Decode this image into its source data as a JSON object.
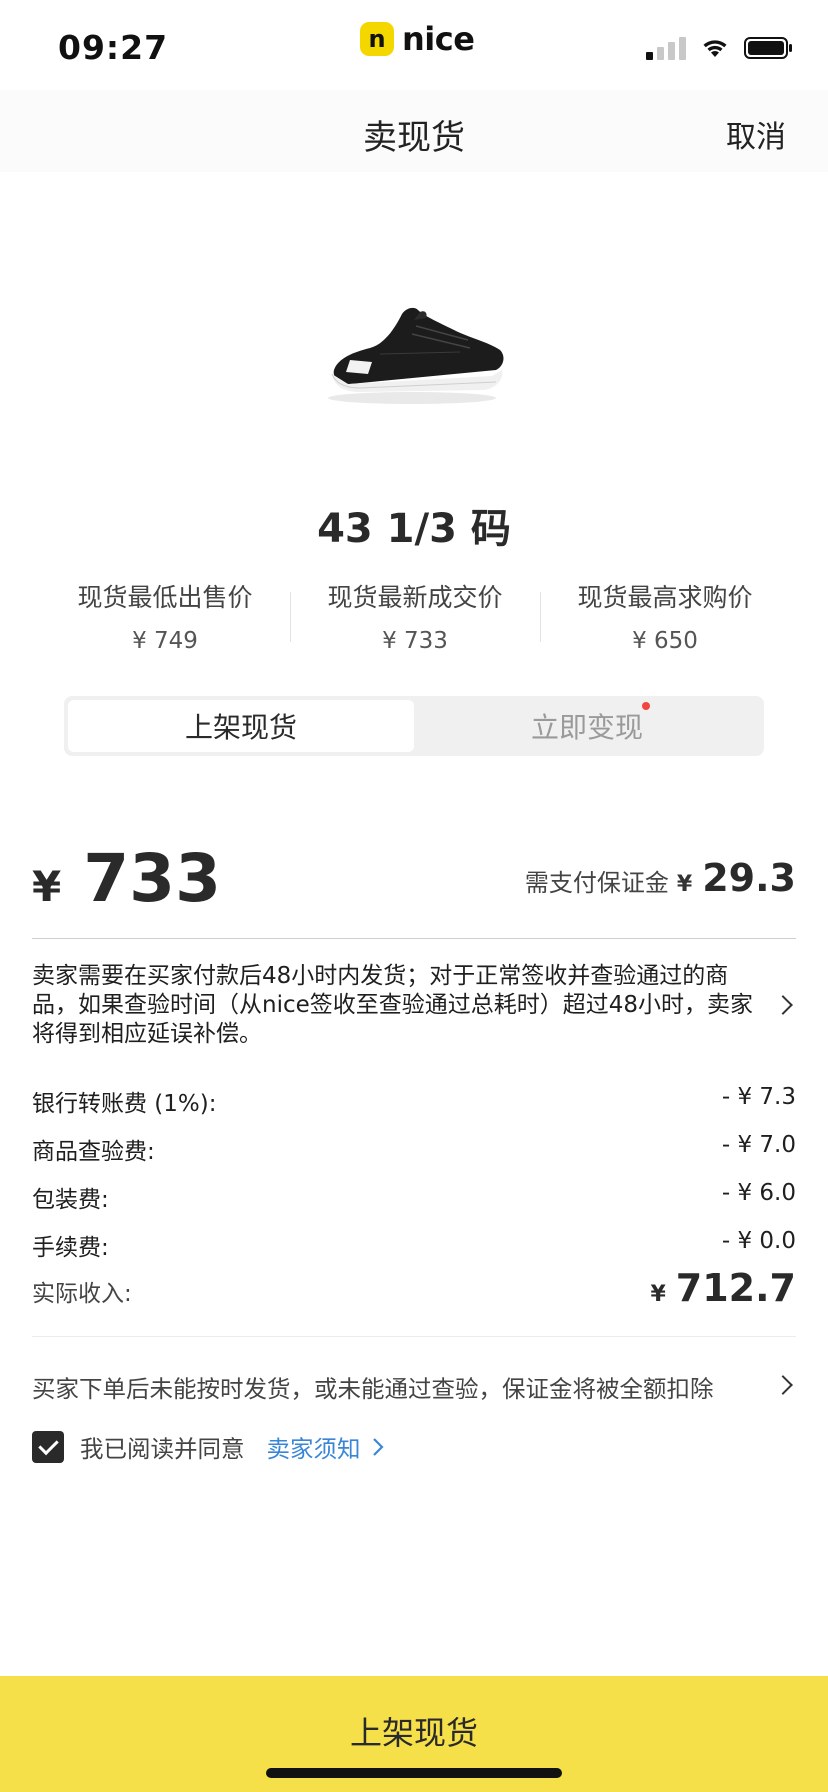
{
  "status_bar": {
    "time": "09:27",
    "carrier_badge": "n",
    "carrier_name": "nice"
  },
  "nav": {
    "title": "卖现货",
    "cancel": "取消"
  },
  "product": {
    "image_icon": "sneaker-image",
    "size": "43 1/3 码"
  },
  "price_stats": [
    {
      "label": "现货最低出售价",
      "value": "¥ 749"
    },
    {
      "label": "现货最新成交价",
      "value": "¥ 733"
    },
    {
      "label": "现货最高求购价",
      "value": "¥ 650"
    }
  ],
  "tabs": [
    {
      "label": "上架现货",
      "active": true
    },
    {
      "label": "立即变现",
      "active": false,
      "badge_dot": true
    }
  ],
  "price": {
    "currency": "¥",
    "amount": "733",
    "deposit_label": "需支付保证金",
    "deposit_currency": "¥",
    "deposit_value": "29.3"
  },
  "notice": {
    "text": "卖家需要在买家付款后48小时内发货；对于正常签收并查验通过的商品，如果查验时间（从nice签收至查验通过总耗时）超过48小时，卖家将得到相应延误补偿。"
  },
  "fees": [
    {
      "label": "银行转账费 (1%):",
      "value": "- ¥ 7.3"
    },
    {
      "label": "商品查验费:",
      "value": "- ¥ 7.0"
    },
    {
      "label": "包装费:",
      "value": "- ¥ 6.0"
    },
    {
      "label": "手续费:",
      "value": "- ¥ 0.0"
    }
  ],
  "income": {
    "label": "实际收入:",
    "currency": "¥",
    "amount": "712.7"
  },
  "penalty": "买家下单后未能按时发货，或未能通过查验，保证金将被全额扣除",
  "agreement": {
    "text": "我已阅读并同意",
    "link": "卖家须知",
    "checked": true
  },
  "bottom_button": "上架现货",
  "colors": {
    "accent_yellow": "#f5e04a",
    "link_blue": "#3a86d6",
    "badge_red": "#f2453d"
  }
}
